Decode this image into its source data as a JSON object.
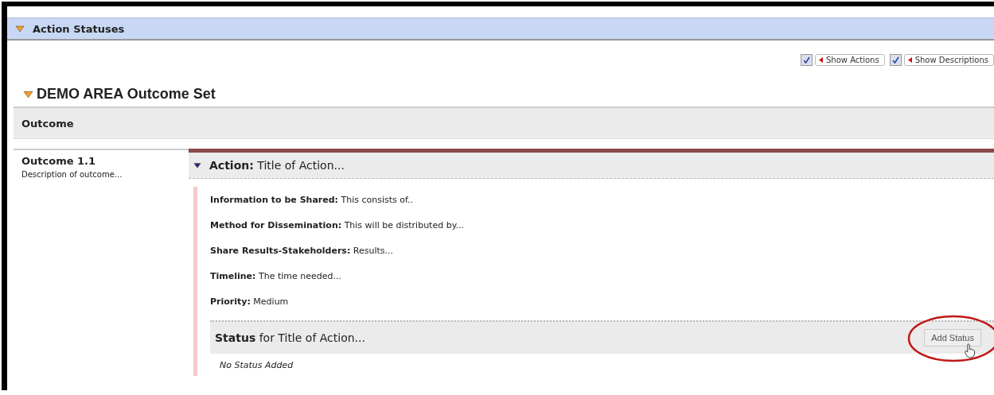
{
  "panel": {
    "title": "Action Statuses",
    "expanded": true
  },
  "toggles": [
    {
      "label": "Show Actions",
      "checked": true
    },
    {
      "label": "Show Descriptions",
      "checked": true
    }
  ],
  "outcome_set": {
    "title": "DEMO AREA Outcome Set",
    "expanded": true
  },
  "table": {
    "column_header": "Outcome"
  },
  "outcome": {
    "name": "Outcome 1.1",
    "description": "Description of outcome..."
  },
  "action": {
    "label": "Action:",
    "title": "Title of Action...",
    "expanded": true,
    "fields": [
      {
        "label": "Information to be Shared:",
        "value": "This consists of.."
      },
      {
        "label": "Method for Dissemination:",
        "value": "This will be distributed by..."
      },
      {
        "label": "Share Results-Stakeholders:",
        "value": "Results..."
      },
      {
        "label": "Timeline:",
        "value": "The time needed..."
      },
      {
        "label": "Priority:",
        "value": "Medium"
      }
    ]
  },
  "status": {
    "title": "**Status** for Title of Action...",
    "empty_text": "No Status Added",
    "button": "Add Status"
  }
}
